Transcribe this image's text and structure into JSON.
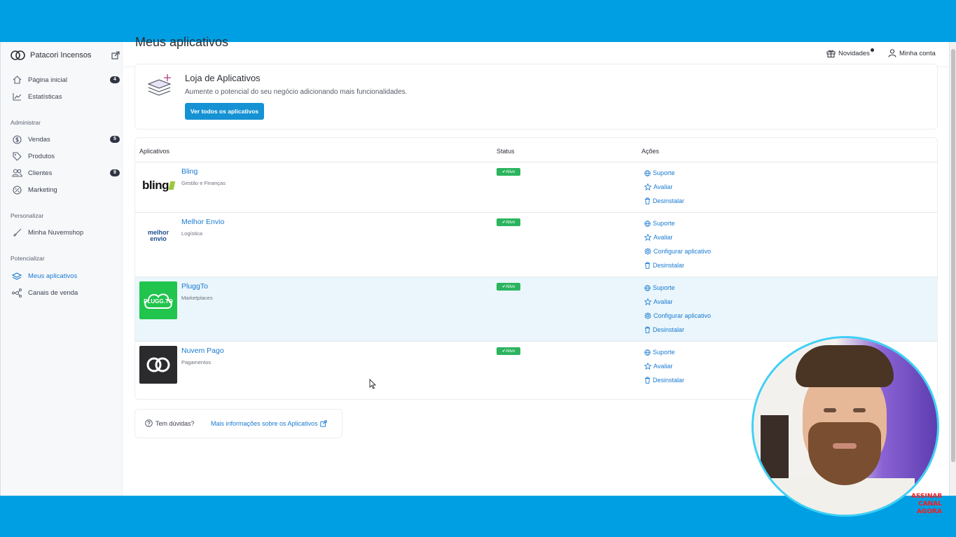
{
  "sidebar": {
    "store_name": "Patacori Incensos",
    "items": [
      {
        "label": "Página inicial",
        "badge": "4"
      },
      {
        "label": "Estatísticas"
      }
    ],
    "sections": [
      {
        "title": "Administrar",
        "items": [
          {
            "label": "Vendas",
            "badge": "5"
          },
          {
            "label": "Produtos"
          },
          {
            "label": "Clientes",
            "badge": "9"
          },
          {
            "label": "Marketing"
          }
        ]
      },
      {
        "title": "Personalizar",
        "items": [
          {
            "label": "Minha Nuvemshop"
          }
        ]
      },
      {
        "title": "Potencializar",
        "items": [
          {
            "label": "Meus aplicativos"
          },
          {
            "label": "Canais de venda"
          }
        ]
      }
    ]
  },
  "topbar": {
    "news": "Novidades",
    "account": "Minha conta"
  },
  "page_title": "Meus aplicativos",
  "store_card": {
    "title": "Loja de Aplicativos",
    "description": "Aumente o potencial do seu negócio adicionando mais funcionalidades.",
    "button": "Ver todos os aplicativos"
  },
  "table": {
    "headers": [
      "Aplicativos",
      "Status",
      "Ações"
    ],
    "rows": [
      {
        "name": "Bling",
        "category": "Gestão e Finanças",
        "status": "Ativo",
        "logo_text": "bling",
        "actions": [
          "Suporte",
          "Avaliar",
          "Desinstalar"
        ]
      },
      {
        "name": "Melhor Envio",
        "category": "Logística",
        "status": "Ativo",
        "logo_text": "melhor envio",
        "actions": [
          "Suporte",
          "Avaliar",
          "Configurar aplicativo",
          "Desinstalar"
        ]
      },
      {
        "name": "PluggTo",
        "category": "Marketplaces",
        "status": "Ativo",
        "logo_text": "PLUGG.TO",
        "actions": [
          "Suporte",
          "Avaliar",
          "Configurar aplicativo",
          "Desinstalar"
        ]
      },
      {
        "name": "Nuvem Pago",
        "category": "Pagamentos",
        "status": "Ativo",
        "actions": [
          "Suporte",
          "Avaliar",
          "Desinstalar"
        ]
      }
    ]
  },
  "help": {
    "question": "Tem dúvidas?",
    "link": "Mais informações sobre os Aplicativos"
  },
  "overlay": {
    "subscribe": "ASSINAR CANAL AGORA"
  },
  "colors": {
    "accent": "#1592d3",
    "link": "#1a7ad1",
    "status_green": "#2bb45e",
    "frame_blue": "#009fe3"
  }
}
